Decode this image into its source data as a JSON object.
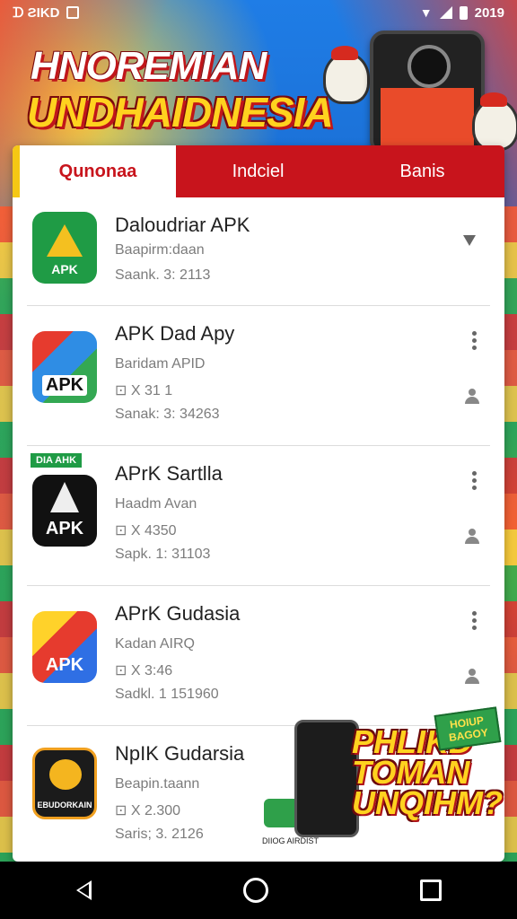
{
  "status_bar": {
    "left_text": "ᗪ ƧIKD",
    "time": "2019"
  },
  "hero": {
    "title": "HNOREMIAN",
    "subtitle": "UNDHAIDNESIA"
  },
  "tabs": [
    {
      "label": "Qunonaa",
      "active": true
    },
    {
      "label": "Indciel",
      "active": false
    },
    {
      "label": "Banis",
      "active": false
    }
  ],
  "apps": [
    {
      "title": "Daloudriar APK",
      "line1": "Baapirm:daan",
      "line2": "Saank. 3: 2113",
      "line3": "",
      "icon_text": "APK"
    },
    {
      "title": "APK Dad Apy",
      "line1": "Baridam APID",
      "line2": "⊡ X 31 1",
      "line3": "Sanak: 3: 34263",
      "icon_text": "APK"
    },
    {
      "title": "APrK Sartlla",
      "line1": "Haadm Avan",
      "line2": "⊡ X 4350",
      "line3": "Sapk. 1: 31103",
      "icon_text": "APK",
      "badge": "DIA AHK"
    },
    {
      "title": "APrK Gudasia",
      "line1": "Kadan AIRQ",
      "line2": "⊡ X 3:46",
      "line3": "Sadkl. 1 151960",
      "icon_text": "APK"
    },
    {
      "title": "NpIK Gudarsia",
      "line1": "Beapin.taann",
      "line2": "⊡ X 2.300",
      "line3": "Saris; 3. 2126",
      "icon_text": "EBUDORKAIN"
    }
  ],
  "promo": {
    "text_line1": "PHLIKD",
    "text_line2": "TOMAN",
    "text_line3": "UNQIHM?",
    "tag": "HOIUP BAGOY",
    "caption": "DIIOG AIRDIST"
  }
}
